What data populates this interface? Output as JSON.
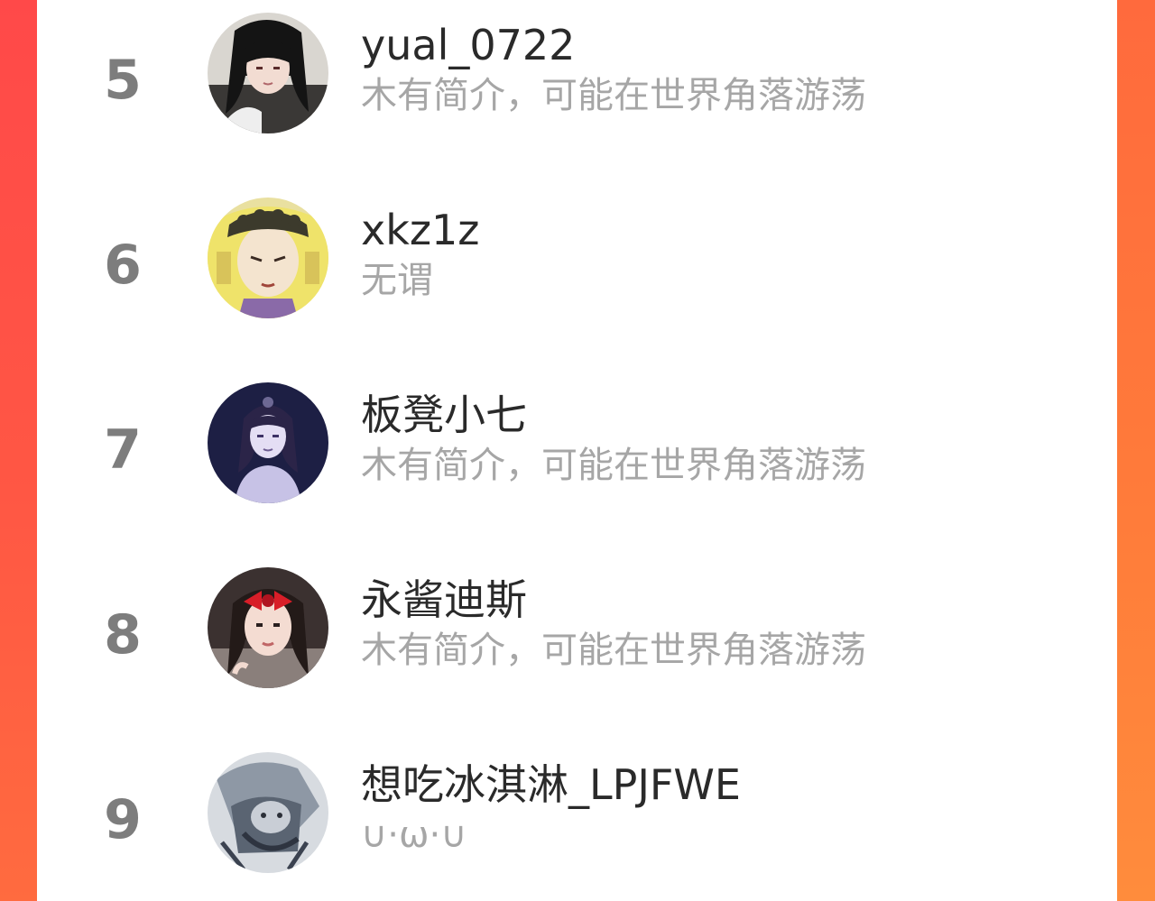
{
  "list": {
    "items": [
      {
        "rank": "5",
        "name": "yual_0722",
        "bio": "木有简介，可能在世界角落游荡",
        "avatar_icon": "avatar-dark-hair-girl-icon"
      },
      {
        "rank": "6",
        "name": "xkz1z",
        "bio": "无谓",
        "avatar_icon": "avatar-yellow-hair-anime-icon"
      },
      {
        "rank": "7",
        "name": "板凳小七",
        "bio": "木有简介，可能在世界角落游荡",
        "avatar_icon": "avatar-purple-anime-boy-icon"
      },
      {
        "rank": "8",
        "name": "永酱迪斯",
        "bio": "木有简介，可能在世界角落游荡",
        "avatar_icon": "avatar-girl-red-bow-icon"
      },
      {
        "rank": "9",
        "name": "想吃冰淇淋_LPJFWE",
        "bio": "∪·ω·∪",
        "avatar_icon": "avatar-grey-sketch-icon"
      }
    ]
  },
  "colors": {
    "background_left": "#ff4b44",
    "background_right": "#ff8c3c",
    "panel": "#ffffff",
    "rank_text": "#7d7d7d",
    "name_text": "#2a2a2a",
    "bio_text": "#a6a6a6"
  }
}
